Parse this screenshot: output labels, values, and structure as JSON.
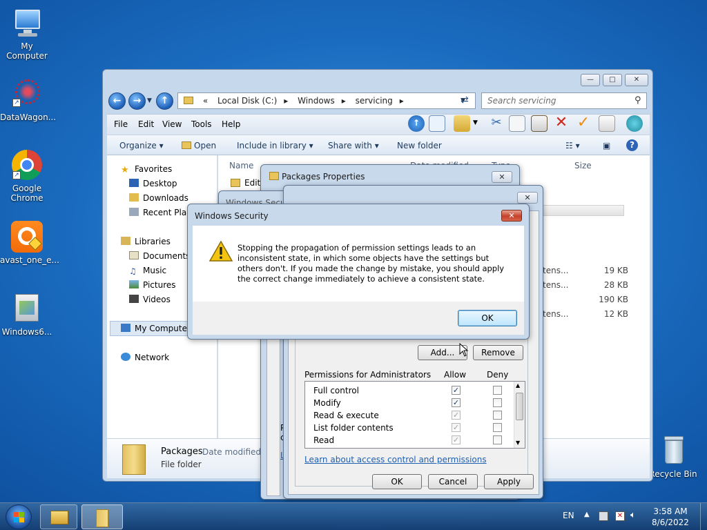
{
  "desktop": {
    "icons": [
      {
        "name": "my-computer",
        "label": "My Computer"
      },
      {
        "name": "datawagon",
        "label": "DataWagon..."
      },
      {
        "name": "google-chrome",
        "label": "Google Chrome"
      },
      {
        "name": "avast",
        "label": "avast_one_e..."
      },
      {
        "name": "windows6",
        "label": "Windows6..."
      },
      {
        "name": "recycle-bin",
        "label": "Recycle Bin"
      }
    ]
  },
  "explorer": {
    "address": {
      "prefix": "«",
      "crumbs": [
        "Local Disk (C:)",
        "Windows",
        "servicing"
      ]
    },
    "search_placeholder": "Search servicing",
    "menu": [
      "File",
      "Edit",
      "View",
      "Tools",
      "Help"
    ],
    "commands": {
      "organize": "Organize",
      "open": "Open",
      "include": "Include in library",
      "share": "Share with",
      "new_folder": "New folder"
    },
    "nav": {
      "favorites": "Favorites",
      "desktop": "Desktop",
      "downloads": "Downloads",
      "recent": "Recent Places",
      "libraries": "Libraries",
      "documents": "Documents",
      "music": "Music",
      "pictures": "Pictures",
      "videos": "Videos",
      "my_computer": "My Computer",
      "network": "Network"
    },
    "columns": {
      "name": "Name",
      "date": "Date modified",
      "type": "Type",
      "size": "Size"
    },
    "files": [
      {
        "name": "Editi",
        "type": "",
        "size": ""
      },
      {
        "name": "",
        "type": "tens...",
        "size": "19 KB"
      },
      {
        "name": "",
        "type": "tens...",
        "size": "28 KB"
      },
      {
        "name": "",
        "type": "",
        "size": "190 KB"
      },
      {
        "name": "",
        "type": "tens...",
        "size": "12 KB"
      }
    ],
    "details": {
      "name": "Packages",
      "date_label": "Date modified: 8",
      "type": "File folder"
    }
  },
  "properties_dialog": {
    "title": "Packages Properties"
  },
  "advanced_dialog": {
    "title": "Windows Security"
  },
  "security_dialog": {
    "add": "Add...",
    "remove": "Remove",
    "perm_header": "Permissions for Administrators",
    "allow": "Allow",
    "deny": "Deny",
    "permissions": [
      {
        "label": "Full control",
        "allow": true,
        "allow_dim": false,
        "deny": false
      },
      {
        "label": "Modify",
        "allow": true,
        "allow_dim": false,
        "deny": false
      },
      {
        "label": "Read & execute",
        "allow": true,
        "allow_dim": true,
        "deny": false
      },
      {
        "label": "List folder contents",
        "allow": true,
        "allow_dim": true,
        "deny": false
      },
      {
        "label": "Read",
        "allow": true,
        "allow_dim": true,
        "deny": false
      }
    ],
    "learn_link": "Learn about access control and permissions",
    "ok": "OK",
    "cancel": "Cancel",
    "apply": "Apply",
    "side_fragments": {
      "p": "P",
      "c": "c",
      "l": "L"
    }
  },
  "warning_dialog": {
    "title": "Windows Security",
    "message": "Stopping the propagation of permission settings leads to an inconsistent state, in which some objects have the settings but others don't. If you made the change by mistake, you should apply the correct change immediately to achieve a consistent state.",
    "ok": "OK"
  },
  "taskbar": {
    "lang": "EN",
    "time": "3:58 AM",
    "date": "8/6/2022"
  }
}
